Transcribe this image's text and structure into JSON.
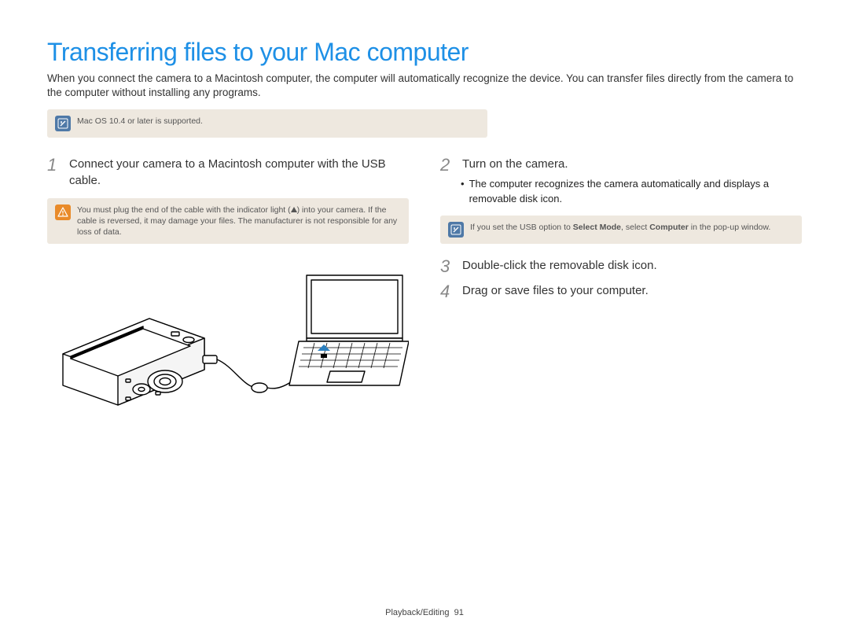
{
  "title": "Transferring files to your Mac computer",
  "intro": "When you connect the camera to a Macintosh computer, the computer will automatically recognize the device. You can transfer files directly from the camera to the computer without installing any programs.",
  "top_note": "Mac OS 10.4 or later is supported.",
  "left": {
    "step1_num": "1",
    "step1_text": "Connect your camera to a Macintosh computer with the USB cable.",
    "warn_before": "You must plug the end of the cable with the indicator light (",
    "warn_after": ") into your camera. If the cable is reversed, it may damage your files. The manufacturer is not responsible for any loss of data."
  },
  "right": {
    "step2_num": "2",
    "step2_text": "Turn on the camera.",
    "step2_bullet": "The computer recognizes the camera automatically and displays a removable disk icon.",
    "note_before": "If you set the USB option to ",
    "note_bold1": "Select Mode",
    "note_mid": ", select ",
    "note_bold2": "Computer",
    "note_after": " in the pop-up window.",
    "step3_num": "3",
    "step3_text": "Double-click the removable disk icon.",
    "step4_num": "4",
    "step4_text": "Drag or save files to your computer."
  },
  "footer": {
    "section": "Playback/Editing",
    "page": "91"
  }
}
